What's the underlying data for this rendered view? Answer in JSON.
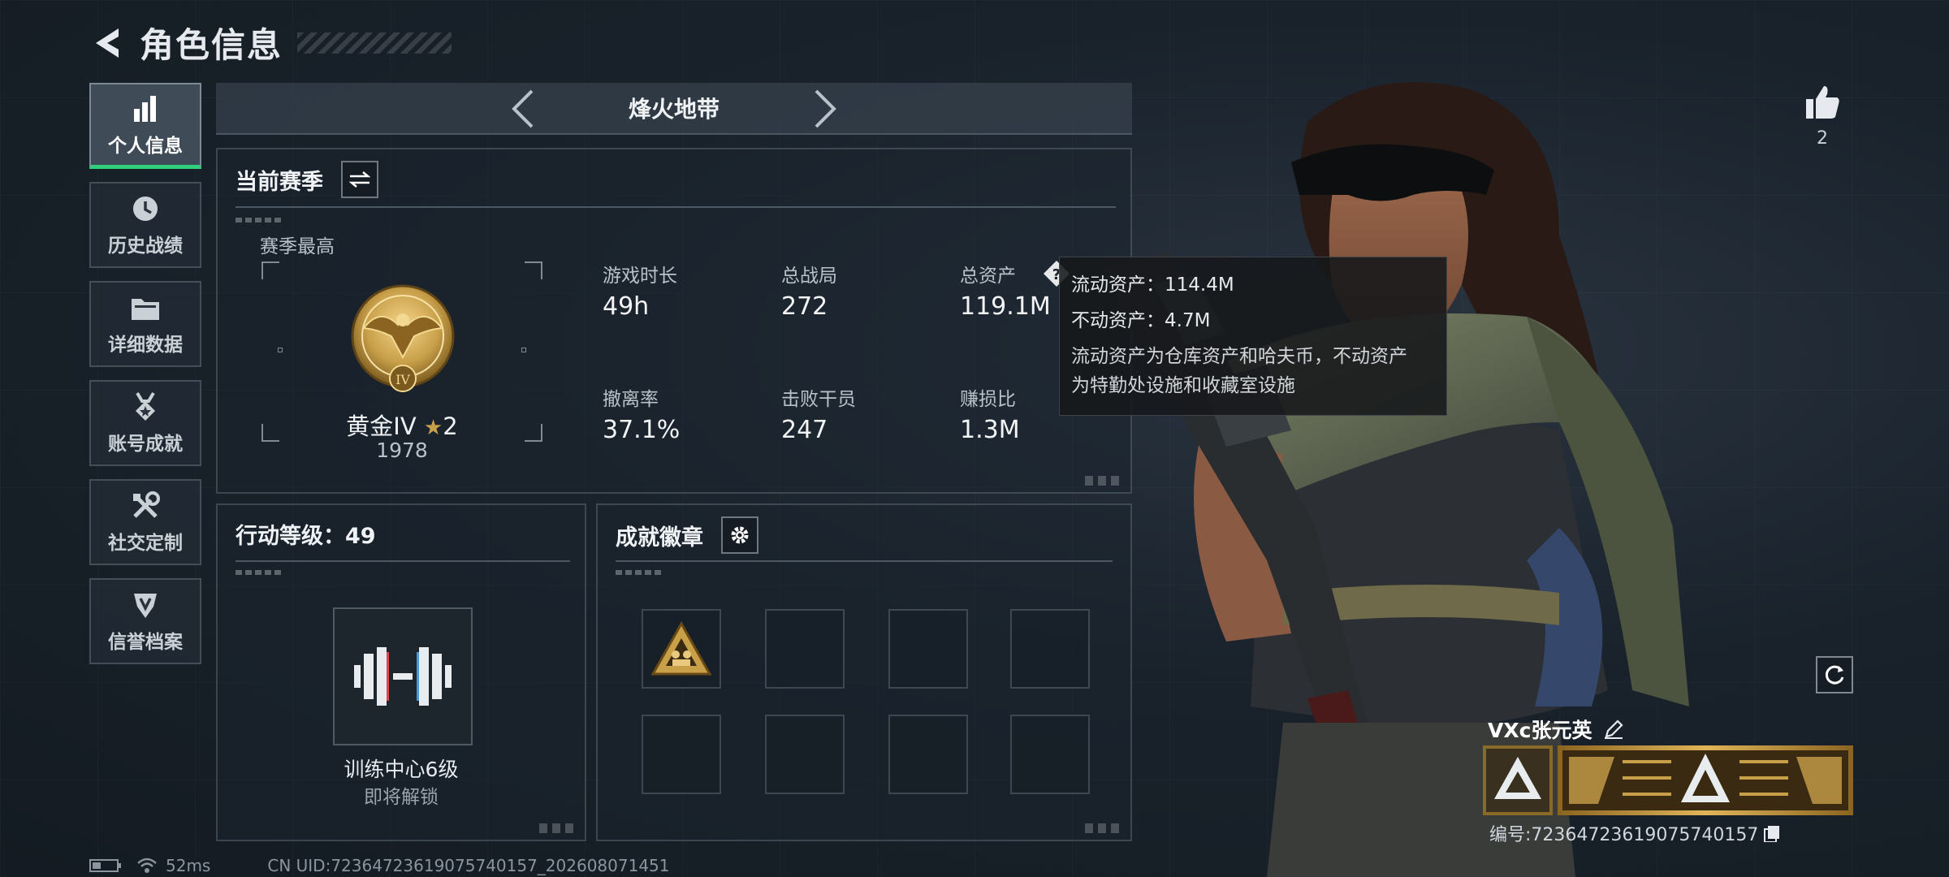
{
  "header": {
    "title": "角色信息"
  },
  "sidebar": {
    "items": [
      {
        "label": "个人信息",
        "icon": "bar-chart-icon",
        "active": true
      },
      {
        "label": "历史战绩",
        "icon": "clock-icon",
        "active": false
      },
      {
        "label": "详细数据",
        "icon": "folder-icon",
        "active": false
      },
      {
        "label": "账号成就",
        "icon": "medal-icon",
        "active": false
      },
      {
        "label": "社交定制",
        "icon": "tools-icon",
        "active": false
      },
      {
        "label": "信誉档案",
        "icon": "shield-emblem-icon",
        "active": false
      }
    ]
  },
  "map_selector": {
    "current": "烽火地带"
  },
  "season": {
    "title": "当前赛季",
    "best_label": "赛季最高",
    "rank_name": "黄金IV",
    "rank_stars": "2",
    "rank_roman": "IV",
    "rank_score": "1978",
    "stats": [
      {
        "label": "游戏时长",
        "value": "49h"
      },
      {
        "label": "总战局",
        "value": "272"
      },
      {
        "label": "总资产",
        "value": "119.1M"
      },
      {
        "label": "撤离率",
        "value": "37.1%"
      },
      {
        "label": "击败干员",
        "value": "247"
      },
      {
        "label": "赚损比",
        "value": "1.3M"
      }
    ]
  },
  "tooltip": {
    "liquid": "流动资产：114.4M",
    "fixed": "不动资产：4.7M",
    "desc_line1": "流动资产为仓库资产和哈夫币，不动资产",
    "desc_line2": "为特勤处设施和收藏室设施"
  },
  "action_level": {
    "title": "行动等级：49",
    "item_name": "训练中心6级",
    "item_status": "即将解锁"
  },
  "achievements": {
    "title": "成就徽章"
  },
  "like": {
    "count": "2"
  },
  "player": {
    "name": "VXc张元英",
    "id": "编号:72364723619075740157"
  },
  "status_bar": {
    "ping": "52ms",
    "uid": "CN UID:72364723619075740157_202608071451"
  },
  "colors": {
    "accent_green": "#2fcf7c",
    "gold": "#c9a04a"
  }
}
